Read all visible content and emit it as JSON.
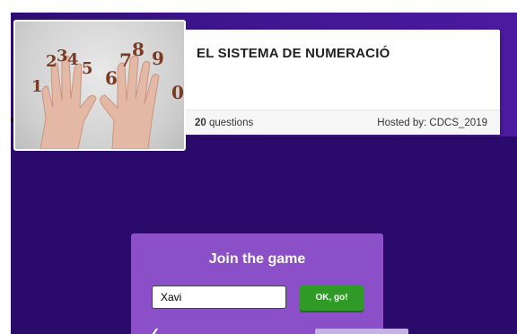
{
  "quiz": {
    "title": "EL SISTEMA DE NUMERACIÓ",
    "question_count": "20",
    "questions_label": " questions",
    "hosted_by": "Hosted by: CDCS_2019"
  },
  "thumbnail": {
    "digits": [
      "1",
      "2",
      "3",
      "4",
      "5",
      "6",
      "7",
      "8",
      "9",
      "0"
    ]
  },
  "join": {
    "title": "Join the game",
    "name_value": "Xavi",
    "ok_label": "OK, go!"
  },
  "colors": {
    "background": "#2a0a6b",
    "join_panel": "#8b4fc8",
    "ok_button": "#2f9a26"
  }
}
